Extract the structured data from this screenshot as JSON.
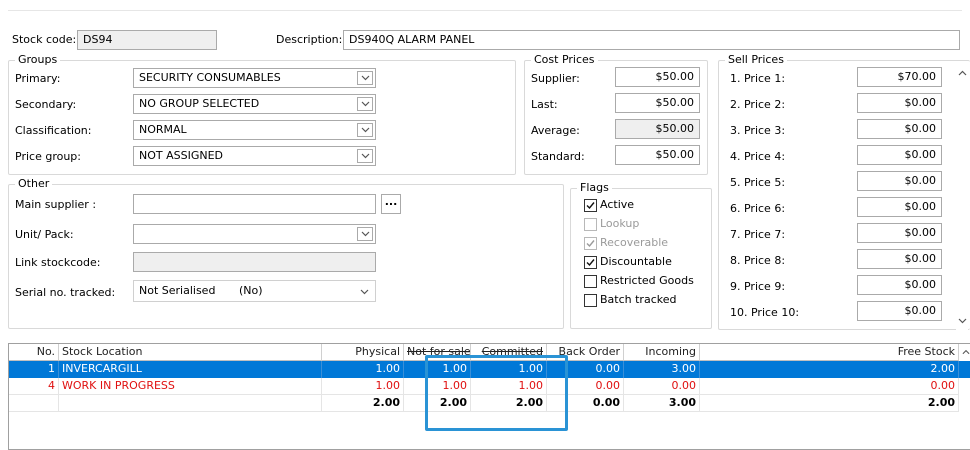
{
  "header": {
    "stock_code_label": "Stock code:",
    "stock_code_value": "DS94",
    "description_label": "Description:",
    "description_value": "DS940Q ALARM PANEL"
  },
  "groups": {
    "title": "Groups",
    "primary_label": "Primary:",
    "primary_value": "SECURITY CONSUMABLES",
    "secondary_label": "Secondary:",
    "secondary_value": "NO GROUP SELECTED",
    "classification_label": "Classification:",
    "classification_value": "NORMAL",
    "price_group_label": "Price group:",
    "price_group_value": "NOT ASSIGNED"
  },
  "cost_prices": {
    "title": "Cost Prices",
    "supplier_label": "Supplier:",
    "supplier_value": "$50.00",
    "last_label": "Last:",
    "last_value": "$50.00",
    "average_label": "Average:",
    "average_value": "$50.00",
    "standard_label": "Standard:",
    "standard_value": "$50.00"
  },
  "sell_prices": {
    "title": "Sell Prices",
    "items": [
      {
        "label": "1. Price 1:",
        "value": "$70.00"
      },
      {
        "label": "2. Price 2:",
        "value": "$0.00"
      },
      {
        "label": "3. Price 3:",
        "value": "$0.00"
      },
      {
        "label": "4. Price 4:",
        "value": "$0.00"
      },
      {
        "label": "5. Price 5:",
        "value": "$0.00"
      },
      {
        "label": "6. Price 6:",
        "value": "$0.00"
      },
      {
        "label": "7. Price 7:",
        "value": "$0.00"
      },
      {
        "label": "8. Price 8:",
        "value": "$0.00"
      },
      {
        "label": "9. Price 9:",
        "value": "$0.00"
      },
      {
        "label": "10. Price 10:",
        "value": "$0.00"
      }
    ]
  },
  "other": {
    "title": "Other",
    "main_supplier_label": "Main supplier :",
    "main_supplier_value": "",
    "browse_label": "...",
    "unit_pack_label": "Unit/ Pack:",
    "unit_pack_value": "",
    "link_stockcode_label": "Link stockcode:",
    "link_stockcode_value": "",
    "serial_label": "Serial no. tracked:",
    "serial_value": "Not Serialised",
    "serial_value_code": "(No)"
  },
  "flags": {
    "title": "Flags",
    "items": [
      {
        "label": "Active",
        "checked": true,
        "enabled": true
      },
      {
        "label": "Lookup",
        "checked": false,
        "enabled": false
      },
      {
        "label": "Recoverable",
        "checked": true,
        "enabled": false
      },
      {
        "label": "Discountable",
        "checked": true,
        "enabled": true
      },
      {
        "label": "Restricted Goods",
        "checked": false,
        "enabled": true
      },
      {
        "label": "Batch tracked",
        "checked": false,
        "enabled": true
      }
    ]
  },
  "stock_grid": {
    "columns": [
      "No.",
      "Stock Location",
      "Physical",
      "Not for sale",
      "Committed",
      "Back Order",
      "Incoming",
      "Free Stock"
    ],
    "rows": [
      {
        "no": "1",
        "location": "INVERCARGILL",
        "physical": "1.00",
        "not_for_sale": "1.00",
        "committed": "1.00",
        "back_order": "0.00",
        "incoming": "3.00",
        "free_stock": "2.00",
        "selected": true
      },
      {
        "no": "4",
        "location": "WORK IN PROGRESS",
        "physical": "1.00",
        "not_for_sale": "1.00",
        "committed": "1.00",
        "back_order": "0.00",
        "incoming": "0.00",
        "free_stock": "0.00",
        "selected": false
      }
    ],
    "totals": {
      "physical": "2.00",
      "not_for_sale": "2.00",
      "committed": "2.00",
      "back_order": "0.00",
      "incoming": "3.00",
      "free_stock": "2.00"
    }
  },
  "colors": {
    "selected_row": "#0078d7",
    "warning_text": "#e01010",
    "highlight_box": "#2a93d5"
  },
  "icons": {
    "dropdown": "chevron-down-icon",
    "checkbox_checked": "checkmark-icon",
    "scroll_up": "chevron-up-icon",
    "scroll_down": "chevron-down-icon"
  }
}
